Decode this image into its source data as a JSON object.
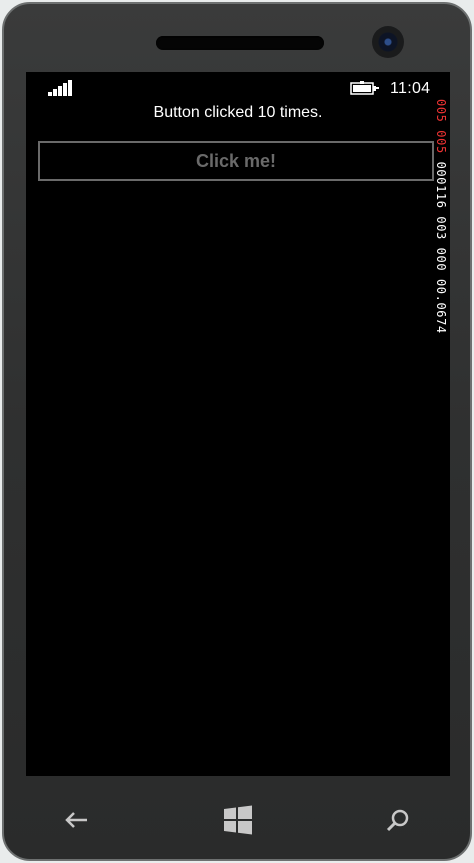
{
  "status": {
    "time": "11:04"
  },
  "main": {
    "message": "Button clicked 10 times.",
    "button_label": "Click me!"
  },
  "frame_counter": {
    "red": "005 005",
    "white": "000116 003 000 00.0674"
  },
  "icons": {
    "signal": "signal-strength-icon",
    "battery": "battery-charging-icon",
    "back": "back-arrow-icon",
    "start": "windows-start-icon",
    "search": "search-icon"
  },
  "colors": {
    "screen": "#000000",
    "frame": "#2f3030",
    "button_border": "#6a6a6a",
    "counter_red": "#e33333"
  }
}
